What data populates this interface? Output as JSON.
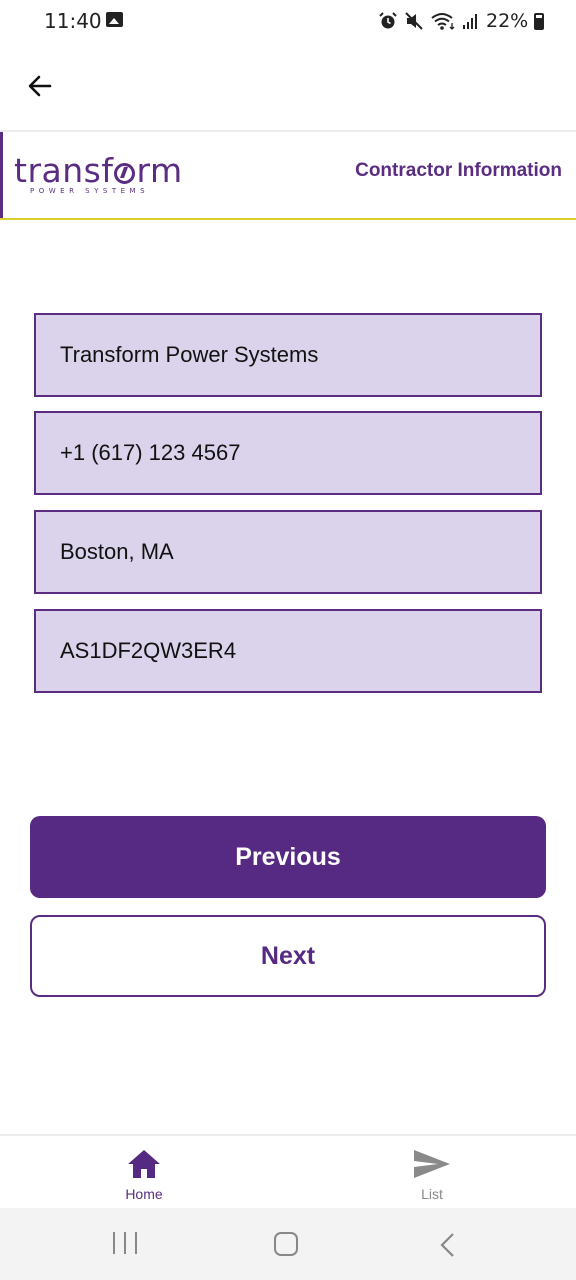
{
  "status_bar": {
    "time": "11:40",
    "battery_percent": "22%",
    "icons": [
      "gallery-icon",
      "alarm-icon",
      "mute-icon",
      "wifi-icon",
      "signal-icon",
      "battery-icon"
    ]
  },
  "app_bar": {
    "back_icon": "arrow-left-icon"
  },
  "header": {
    "logo_word_part1": "transf",
    "logo_word_part2": "rm",
    "logo_subtitle": "POWER SYSTEMS",
    "title": "Contractor Information"
  },
  "fields": [
    {
      "value": "Transform Power Systems"
    },
    {
      "value": "+1 (617) 123 4567"
    },
    {
      "value": "Boston, MA"
    },
    {
      "value": "AS1DF2QW3ER4"
    }
  ],
  "buttons": {
    "previous_label": "Previous",
    "next_label": "Next"
  },
  "bottom_nav": {
    "items": [
      {
        "label": "Home",
        "icon": "home-icon",
        "active": true
      },
      {
        "label": "List",
        "icon": "send-icon",
        "active": false
      }
    ]
  },
  "colors": {
    "brand_purple": "#562a82",
    "field_fill": "#dbd3eb",
    "header_underline": "#d8cf2a"
  }
}
